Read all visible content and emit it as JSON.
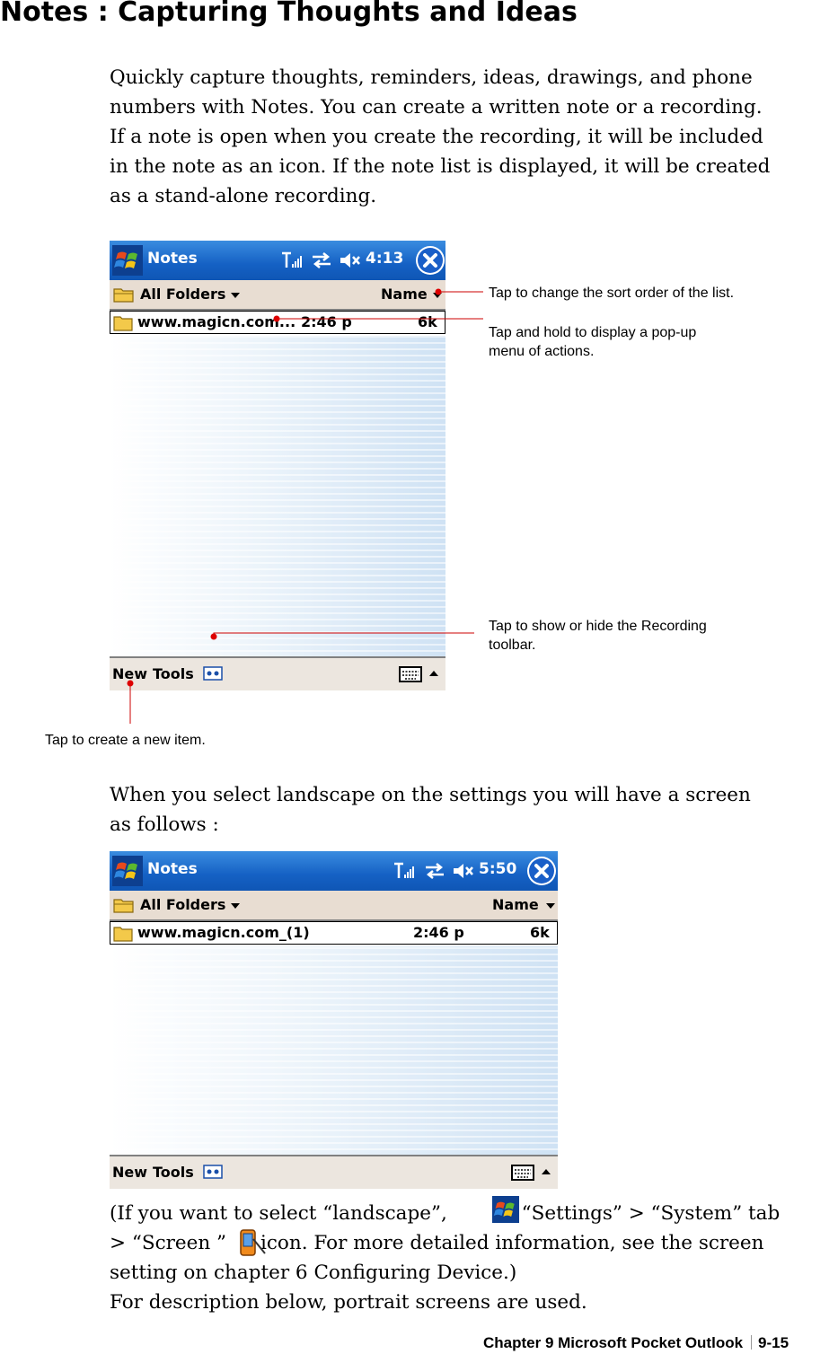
{
  "title": "Notes : Capturing Thoughts and Ideas",
  "intro_lines": [
    "Quickly capture thoughts, reminders, ideas, drawings, and phone",
    "numbers with Notes. You can create a written note or a recording.",
    "If a note is open when you create the recording, it will be included",
    "in the note as an icon. If the note list is displayed, it will be created",
    "as a stand-alone recording."
  ],
  "portrait": {
    "app_title": "Notes",
    "time": "4:13",
    "folder_label": "All Folders",
    "sort_label": "Name",
    "row": {
      "name": "www.magicn.com...",
      "time": "2:46 p",
      "size": "6k"
    },
    "menu": {
      "new": "New",
      "tools": "Tools"
    }
  },
  "annotations": {
    "sort": "Tap to change the sort order of the list.",
    "popup_1": "Tap and hold to display a pop-up",
    "popup_2": "menu of actions.",
    "recording_1": "Tap to show or hide the Recording",
    "recording_2": "toolbar.",
    "new_item": "Tap to create a new item."
  },
  "landscape_lines": [
    "When you select landscape on the settings you will have a screen",
    "as follows :"
  ],
  "landscape": {
    "app_title": "Notes",
    "time": "5:50",
    "folder_label": "All Folders",
    "sort_label": "Name",
    "row": {
      "name": "www.magicn.com_(1)",
      "time": "2:46 p",
      "size": "6k"
    },
    "menu": {
      "new": "New",
      "tools": "Tools"
    }
  },
  "bottom": {
    "l1_a": "(If you want to select “landscape”,",
    "l1_b": "> “Settings” > “System” tab",
    "l2_a": "> “Screen ”",
    "l2_b": "icon. For more detailed information, see the screen",
    "l3": "setting on chapter 6 Configuring Device.)",
    "l4": "For description below, portrait screens are used."
  },
  "footer": {
    "chapter": "Chapter 9 Microsoft Pocket Outlook",
    "page": "9-15"
  },
  "icons": [
    "windows-start-icon",
    "signal-icon",
    "sync-icon",
    "speaker-mute-icon",
    "close-icon",
    "folder-icon",
    "dropdown-arrow-icon",
    "note-file-icon",
    "recording-toolbar-icon",
    "keyboard-icon",
    "screen-settings-icon"
  ],
  "colors": {
    "titlebar": "#1561c4",
    "header": "#e8ddd2",
    "callout_line": "#cc0000"
  }
}
